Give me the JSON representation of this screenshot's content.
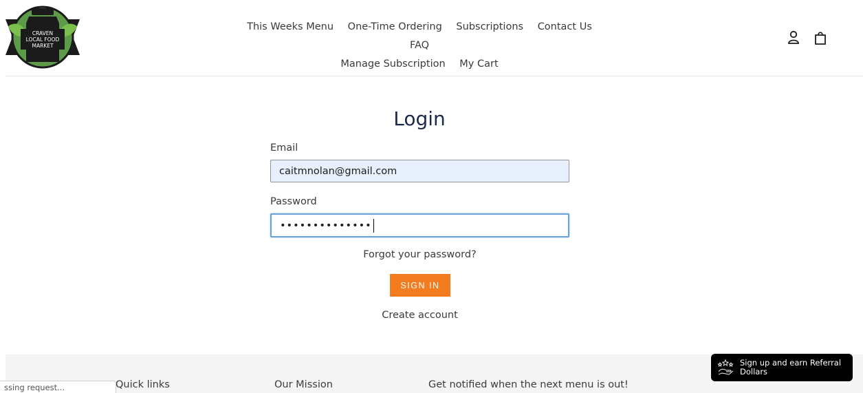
{
  "header": {
    "logo_text": [
      "CRAVEN",
      "LOCAL FOOD",
      "MARKET"
    ],
    "nav_row1": [
      "This Weeks Menu",
      "One-Time Ordering",
      "Subscriptions",
      "Contact Us",
      "FAQ"
    ],
    "nav_row2": [
      "Manage Subscription",
      "My Cart"
    ],
    "icons": [
      "account-icon",
      "cart-icon"
    ]
  },
  "login": {
    "title": "Login",
    "email_label": "Email",
    "email_value": "caitmnolan@gmail.com",
    "password_label": "Password",
    "password_mask": "••••••••••••••",
    "forgot_link": "Forgot your password?",
    "signin_button": "SIGN IN",
    "create_link": "Create account"
  },
  "footer": {
    "quick_links": "Quick links",
    "mission": "Our Mission",
    "notify": "Get notified when the next menu is out!"
  },
  "status_bar": "ssing request...",
  "referral": {
    "text": "Sign up and earn Referral Dollars",
    "icon": "stars-hand-icon"
  },
  "colors": {
    "accent": "#f47c20",
    "title": "#1c2a4a",
    "autofill": "#e8f0fe",
    "focus": "#6aa2d8",
    "logo_green": "#4a8a3c"
  }
}
